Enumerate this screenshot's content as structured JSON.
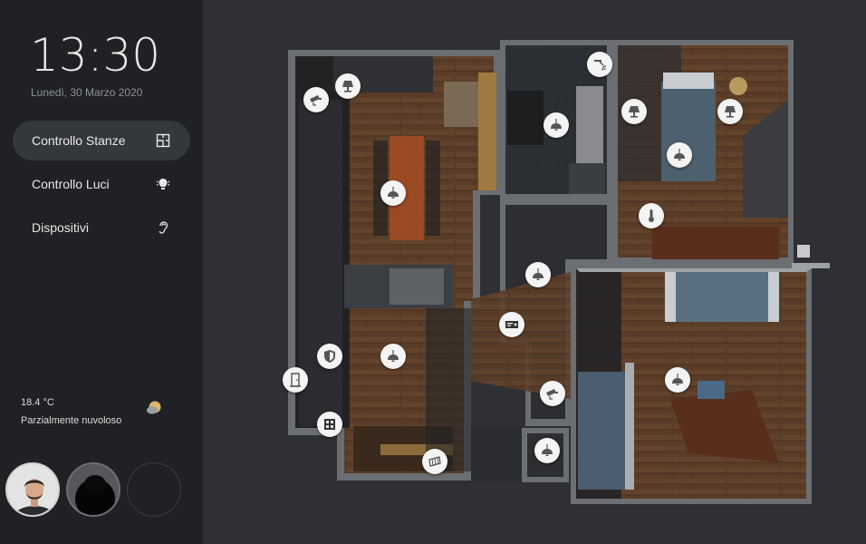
{
  "clock": {
    "time": "13:30",
    "date": "Lunedì, 30 Marzo 2020"
  },
  "nav": [
    {
      "label": "Controllo Stanze",
      "icon": "floorplan-icon",
      "active": true
    },
    {
      "label": "Controllo Luci",
      "icon": "light-bulb-icon",
      "active": false
    },
    {
      "label": "Dispositivi",
      "icon": "ear-icon",
      "active": false
    }
  ],
  "weather": {
    "temperature": "18.4 °C",
    "condition": "Parzialmente nuvoloso",
    "icon": "partly-cloudy-icon"
  },
  "users": [
    {
      "name": "user-avatar-1"
    },
    {
      "name": "user-avatar-2"
    },
    {
      "name": "user-avatar-empty"
    }
  ],
  "floorplan": {
    "devices": [
      {
        "id": "camera-living",
        "icon": "security-camera-icon"
      },
      {
        "id": "lamp-living",
        "icon": "table-lamp-icon"
      },
      {
        "id": "light-dining",
        "icon": "ceiling-light-icon"
      },
      {
        "id": "light-bathroom",
        "icon": "ceiling-light-icon"
      },
      {
        "id": "shower-bathroom",
        "icon": "shower-icon"
      },
      {
        "id": "lamp-bedroom-left",
        "icon": "table-lamp-icon"
      },
      {
        "id": "lamp-bedroom-right",
        "icon": "table-lamp-icon"
      },
      {
        "id": "light-bedroom",
        "icon": "ceiling-light-icon"
      },
      {
        "id": "thermostat-bedroom",
        "icon": "thermometer-icon"
      },
      {
        "id": "light-hallway",
        "icon": "ceiling-light-icon"
      },
      {
        "id": "media-hallway",
        "icon": "media-player-icon"
      },
      {
        "id": "alarm-living",
        "icon": "shield-icon"
      },
      {
        "id": "light-living",
        "icon": "ceiling-light-icon"
      },
      {
        "id": "door-entrance",
        "icon": "door-icon"
      },
      {
        "id": "panel-entrance",
        "icon": "control-panel-icon"
      },
      {
        "id": "camera-hall",
        "icon": "security-camera-icon"
      },
      {
        "id": "light-study",
        "icon": "ceiling-light-icon"
      },
      {
        "id": "light-wc",
        "icon": "ceiling-light-icon"
      },
      {
        "id": "heater-living",
        "icon": "radiator-icon"
      }
    ]
  }
}
